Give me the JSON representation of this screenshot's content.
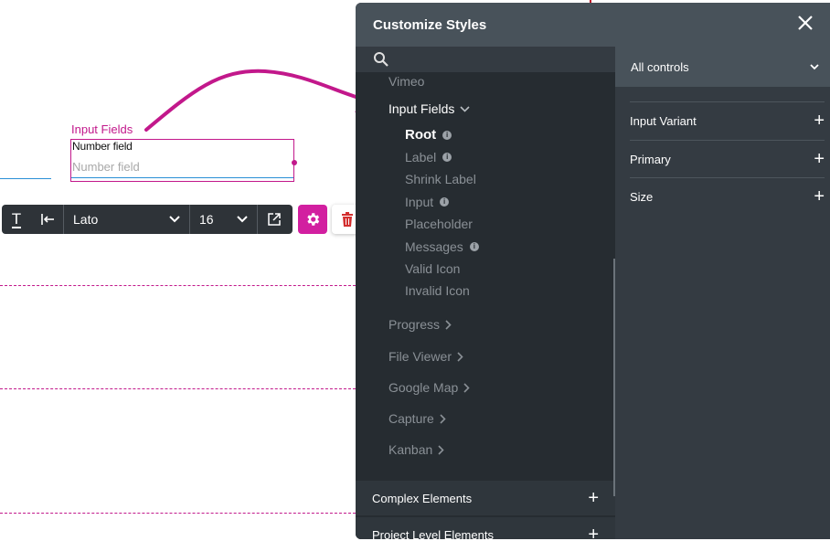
{
  "canvas": {
    "input_label": "Input Fields",
    "field_label": "Number field",
    "field_placeholder": "Number field"
  },
  "toolbar": {
    "text_icon": "T",
    "align_icon": "align-left-icon",
    "font": "Lato",
    "size": "16"
  },
  "panel": {
    "title": "Customize Styles",
    "search_placeholder": "",
    "tree": {
      "vimeo": "Vimeo",
      "input_fields": "Input Fields",
      "sub_items": [
        {
          "label": "Root",
          "info": true
        },
        {
          "label": "Label",
          "info": true
        },
        {
          "label": "Shrink Label",
          "info": false
        },
        {
          "label": "Input",
          "info": true
        },
        {
          "label": "Placeholder",
          "info": false
        },
        {
          "label": "Messages",
          "info": true
        },
        {
          "label": "Valid Icon",
          "info": false
        },
        {
          "label": "Invalid Icon",
          "info": false
        }
      ],
      "groups": [
        "Progress",
        "File Viewer",
        "Google Map",
        "Capture",
        "Kanban"
      ]
    },
    "sections": {
      "complex": "Complex Elements",
      "project": "Project Level Elements"
    },
    "controls_select": "All controls",
    "properties": [
      "Input Variant",
      "Primary",
      "Size"
    ]
  },
  "colors": {
    "accent": "#c2188b",
    "gear_button": "#d21fa0",
    "trash_icon": "#d32f2f",
    "panel_bg": "#343b42",
    "tree_bg": "#262c31"
  }
}
